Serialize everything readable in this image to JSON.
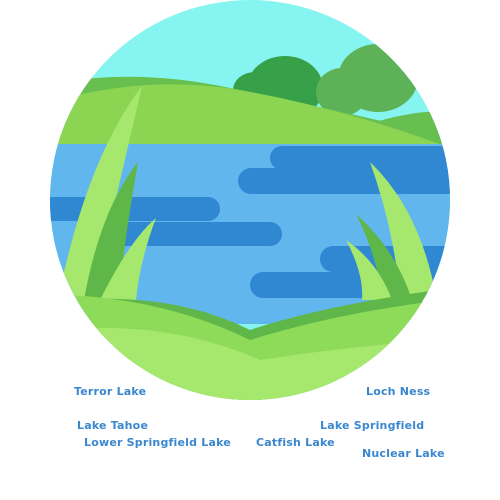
{
  "illustration": {
    "icon": "lake-landscape-icon",
    "colors": {
      "sky": "#86f5f1",
      "hill_back": "#67bf4f",
      "hill_mid": "#8bd552",
      "tree_dark": "#36a149",
      "tree_light": "#5db257",
      "water_light": "#62b6ee",
      "water_dark": "#2f88d1",
      "grass_front": "#8edb5a",
      "grass_bright": "#a6e86d",
      "grass_dark": "#60b749",
      "label_text": "#3a87cf"
    }
  },
  "labels": {
    "terror_lake": "Terror Lake",
    "loch_ness": "Loch Ness",
    "lake_tahoe": "Lake Tahoe",
    "lake_springfield": "Lake Springfield",
    "lower_springfield_lake": "Lower Springfield Lake",
    "catfish_lake": "Catfish Lake",
    "nuclear_lake": "Nuclear Lake"
  }
}
